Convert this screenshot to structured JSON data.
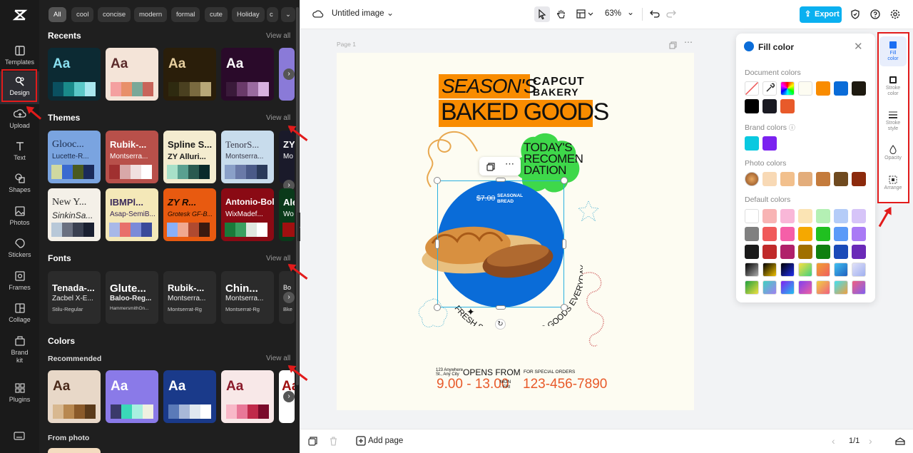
{
  "rail": {
    "items": [
      {
        "label": "Templates",
        "icon": "templates-icon"
      },
      {
        "label": "Design",
        "icon": "design-icon"
      },
      {
        "label": "Upload",
        "icon": "upload-icon"
      },
      {
        "label": "Text",
        "icon": "text-icon"
      },
      {
        "label": "Shapes",
        "icon": "shapes-icon"
      },
      {
        "label": "Photos",
        "icon": "photos-icon"
      },
      {
        "label": "Stickers",
        "icon": "stickers-icon"
      },
      {
        "label": "Frames",
        "icon": "frames-icon"
      },
      {
        "label": "Collage",
        "icon": "collage-icon"
      },
      {
        "label": "Brand kit",
        "icon": "brand-kit-icon"
      },
      {
        "label": "Plugins",
        "icon": "plugins-icon"
      }
    ]
  },
  "panel": {
    "chips": [
      "All",
      "cool",
      "concise",
      "modern",
      "formal",
      "cute",
      "Holiday",
      "c"
    ],
    "recents": {
      "title": "Recents",
      "view_all": "View all"
    },
    "themes": {
      "title": "Themes",
      "view_all": "View all",
      "cards": [
        {
          "t1": "Glooc...",
          "t2": "Lucette-R..."
        },
        {
          "t1": "Rubik-...",
          "t2": "Montserra..."
        },
        {
          "t1": "Spline S...",
          "t2": "ZY Alluri..."
        },
        {
          "t1": "TenorS...",
          "t2": "Montserra..."
        },
        {
          "t1": "ZY",
          "t2": "Mo"
        },
        {
          "t1": "New Y...",
          "t2": "SinkinSa..."
        },
        {
          "t1": "IBMPl...",
          "t2": "Asap-SemiB..."
        },
        {
          "t1": "ZY R...",
          "t2": "Grotesk GF-B..."
        },
        {
          "t1": "Antonio-Bold",
          "t2": "WixMadef..."
        },
        {
          "t1": "Ale",
          "t2": "Wo"
        }
      ]
    },
    "fonts": {
      "title": "Fonts",
      "view_all": "View all",
      "cards": [
        {
          "f1": "Tenada-...",
          "f2": "Zacbel X-E...",
          "f3": "Stilu-Regular"
        },
        {
          "f1": "Glute...",
          "f2": "Baloo-Reg...",
          "f3": "HammersmithOn..."
        },
        {
          "f1": "Rubik-...",
          "f2": "Montserra...",
          "f3": "Montserrat-Rg"
        },
        {
          "f1": "Chin...",
          "f2": "Montserra...",
          "f3": "Montserrat-Rg"
        },
        {
          "f1": "Bo",
          "f2": "",
          "f3": "Bke"
        }
      ]
    },
    "colors": {
      "title": "Colors",
      "recommended": "Recommended",
      "view_all": "View all"
    },
    "from_photo": "From photo",
    "aa": "Aa"
  },
  "topbar": {
    "title": "Untitled image",
    "zoom": "63%",
    "export": "Export"
  },
  "page": {
    "label": "Page 1"
  },
  "poster": {
    "seasons": "SEASON'S",
    "brand1": "CAPCUT",
    "brand2": "BAKERY",
    "baked": "BAKED GOODS",
    "today1": "TODAY'S",
    "today2": "RECOMEN",
    "today3": "DATION",
    "price": "$7.00",
    "seasonal1": "SEASONAL",
    "seasonal2": "BREAD",
    "arc1": "FRESH SEASONAL BAKED GOODS EVERYDAY",
    "opens": "OPENS FROM",
    "hours": "9.00 - 13.00",
    "days1": "MON",
    "days2": "- FRI",
    "special": "FOR SPECIAL ORDERS",
    "phone": "123-456-7890",
    "tiny1": "123 Anywhere",
    "tiny2": "St., Any City"
  },
  "fill_panel": {
    "title": "Fill color",
    "document_colors": "Document colors",
    "brand_colors": "Brand colors",
    "photo_colors": "Photo colors",
    "default_colors": "Default colors",
    "doc_swatches": [
      "#ffffff",
      "#eyedrop",
      "#rainbow",
      "#fdfcf2",
      "#f98c00",
      "#0a6cd8",
      "#1e1a10",
      "#000000",
      "#1a1a22",
      "#e85a2a"
    ],
    "brand_swatches": [
      "#0ac9e0",
      "#7b22f0"
    ],
    "photo_swatches": [
      "#photo",
      "#f8d9b5",
      "#f2c08d",
      "#e3ad7b",
      "#c47b3c",
      "#6f4a1f",
      "#8c2a0c"
    ],
    "default_rows": [
      [
        "#ffffff",
        "#f8b4b4",
        "#f9b7d8",
        "#fbe4b4",
        "#b4f0b4",
        "#b4ccf8",
        "#d6c4f8"
      ],
      [
        "#808080",
        "#f05a5a",
        "#f55fa8",
        "#f5a800",
        "#20c020",
        "#5a9af8",
        "#a97af5"
      ],
      [
        "#1a1a1a",
        "#c02a2a",
        "#b0206a",
        "#a07000",
        "#108010",
        "#1a4ab8",
        "#6a2ab8"
      ],
      [
        "#grad1",
        "#grad2",
        "#grad3",
        "#grad4",
        "#grad5",
        "#grad6",
        "#grad7"
      ],
      [
        "#grad8",
        "#grad9",
        "#grad10",
        "#grad11",
        "#grad12",
        "#grad13",
        "#grad14"
      ]
    ]
  },
  "right_side": {
    "items": [
      {
        "label": "Fill color",
        "icon": "fill-color-icon"
      },
      {
        "label": "Stroke color",
        "icon": "stroke-color-icon"
      },
      {
        "label": "Stroke style",
        "icon": "stroke-style-icon"
      },
      {
        "label": "Opacity",
        "icon": "opacity-icon"
      },
      {
        "label": "Arrange",
        "icon": "arrange-icon"
      }
    ]
  },
  "bottombar": {
    "add_page": "Add page",
    "pagination": "1/1"
  },
  "colors": {
    "accent": "#1c6ef2",
    "export_bg": "#00b0f0",
    "annotation": "#e21b1b"
  }
}
